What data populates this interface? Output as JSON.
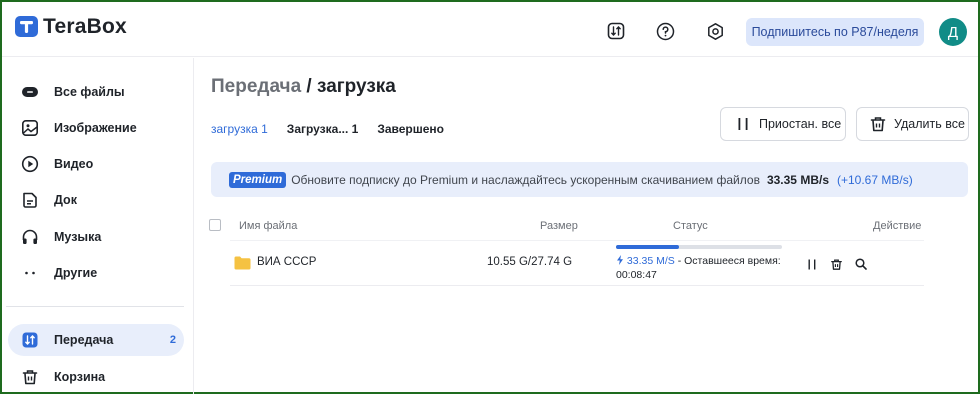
{
  "app": {
    "name": "TeraBox"
  },
  "header": {
    "subscribe_label": "Подпишитесь по P87/неделя",
    "avatar_initial": "Д",
    "icons": [
      "transfer-icon",
      "help-icon",
      "settings-icon"
    ]
  },
  "sidebar": {
    "items": [
      {
        "label": "Все файлы",
        "icon": "all-files-icon"
      },
      {
        "label": "Изображение",
        "icon": "image-icon"
      },
      {
        "label": "Видео",
        "icon": "video-icon"
      },
      {
        "label": "Док",
        "icon": "document-icon"
      },
      {
        "label": "Музыка",
        "icon": "headphones-icon"
      },
      {
        "label": "Другие",
        "icon": "more-icon"
      },
      {
        "label": "Передача",
        "icon": "transfer-icon",
        "count": "2",
        "active": true
      },
      {
        "label": "Корзина",
        "icon": "trash-icon"
      }
    ]
  },
  "main": {
    "title_part1": "Передача",
    "title_sep": " / ",
    "title_part2": "загрузка",
    "tabs": [
      {
        "label": "загрузка 1",
        "active": true
      },
      {
        "label": "Загрузка... 1"
      },
      {
        "label": "Завершено"
      }
    ],
    "pause_all_label": "Приостан. все",
    "delete_all_label": "Удалить все",
    "premium": {
      "badge": "Premium",
      "text": "Обновите подписку до Premium и наслаждайтесь ускоренным скачиванием файлов",
      "speed": "33.35 MB/s",
      "extra": "(+10.67 MB/s)"
    },
    "table": {
      "headers": {
        "name": "Имя файла",
        "size": "Размер",
        "status": "Статус",
        "action": "Действие"
      },
      "rows": [
        {
          "name": "ВИА СССР",
          "size": "10.55 G/27.74 G",
          "progress": 0.38,
          "speed": "33.35 M/S",
          "remaining_label": " - Оставшееся время:",
          "remaining_time": "00:08:47"
        }
      ]
    }
  },
  "colors": {
    "accent": "#2f6bd8",
    "avatar": "#118c87",
    "folder": "#f5c242",
    "subscribe_bg": "#dce6fb"
  }
}
